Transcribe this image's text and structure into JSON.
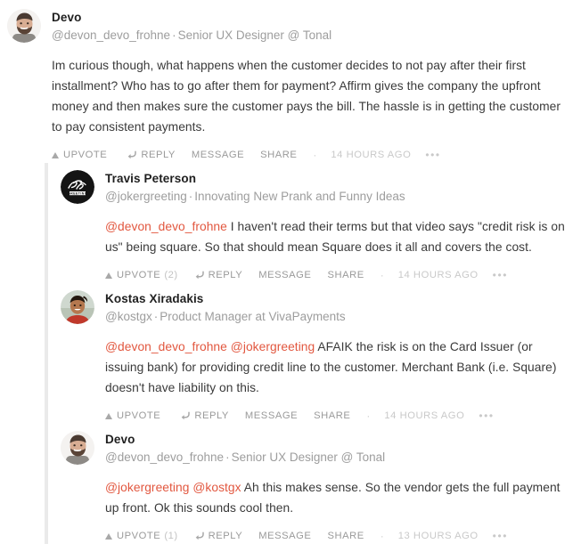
{
  "thread": {
    "root": {
      "author": "Devo",
      "handle": "@devon_devo_frohne",
      "separator": "·",
      "title": "Senior UX Designer @ Tonal",
      "avatar": "man-bearded-avatar",
      "text_segments": [
        {
          "type": "text",
          "value": "Im curious though, what happens when the customer decides to not pay after their first installment? Who has to go after them for payment? Affirm gives the company the upfront money and then makes sure the customer pays the bill. The hassle is in getting the customer to pay consistent payments."
        }
      ],
      "actions": {
        "upvote_label": "UPVOTE",
        "upvote_count": "",
        "reply_label": "REPLY",
        "message_label": "MESSAGE",
        "share_label": "SHARE",
        "separator": "·",
        "timestamp": "14 HOURS AGO",
        "more_label": "•••"
      }
    },
    "replies": [
      {
        "author": "Travis Peterson",
        "handle": "@jokergreeting",
        "separator": "·",
        "title": "Innovating New Prank and Funny Ideas",
        "avatar": "joker-greeting-logo",
        "text_segments": [
          {
            "type": "mention",
            "value": "@devon_devo_frohne"
          },
          {
            "type": "text",
            "value": " I haven't read their terms but that video says \"credit risk is on us\" being square. So that should mean Square does it all and covers the cost."
          }
        ],
        "actions": {
          "upvote_label": "UPVOTE",
          "upvote_count": "(2)",
          "reply_label": "REPLY",
          "message_label": "MESSAGE",
          "share_label": "SHARE",
          "separator": "·",
          "timestamp": "14 HOURS AGO",
          "more_label": "•••"
        }
      },
      {
        "author": "Kostas Xiradakis",
        "handle": "@kostgx",
        "separator": "·",
        "title": "Product Manager at VivaPayments",
        "avatar": "man-smiling-avatar",
        "text_segments": [
          {
            "type": "mention",
            "value": "@devon_devo_frohne"
          },
          {
            "type": "text",
            "value": " "
          },
          {
            "type": "mention",
            "value": "@jokergreeting"
          },
          {
            "type": "text",
            "value": " AFAIK the risk is on the Card Issuer (or issuing bank) for providing credit line to the customer. Merchant Bank (i.e. Square) doesn't have liability on this."
          }
        ],
        "actions": {
          "upvote_label": "UPVOTE",
          "upvote_count": "",
          "reply_label": "REPLY",
          "message_label": "MESSAGE",
          "share_label": "SHARE",
          "separator": "·",
          "timestamp": "14 HOURS AGO",
          "more_label": "•••"
        }
      },
      {
        "author": "Devo",
        "handle": "@devon_devo_frohne",
        "separator": "·",
        "title": "Senior UX Designer @ Tonal",
        "avatar": "man-bearded-avatar",
        "text_segments": [
          {
            "type": "mention",
            "value": "@jokergreeting"
          },
          {
            "type": "text",
            "value": " "
          },
          {
            "type": "mention",
            "value": "@kostgx"
          },
          {
            "type": "text",
            "value": " Ah this makes sense. So the vendor gets the full payment up front. Ok this sounds cool then."
          }
        ],
        "actions": {
          "upvote_label": "UPVOTE",
          "upvote_count": "(1)",
          "reply_label": "REPLY",
          "message_label": "MESSAGE",
          "share_label": "SHARE",
          "separator": "·",
          "timestamp": "13 HOURS AGO",
          "more_label": "•••"
        }
      }
    ]
  },
  "colors": {
    "mention": "#e2573f",
    "body_text": "#3a3a3a",
    "muted": "#9d9d9d",
    "action": "#a8a8a8",
    "thread_line": "#eaeaea",
    "background": "#ffffff"
  }
}
